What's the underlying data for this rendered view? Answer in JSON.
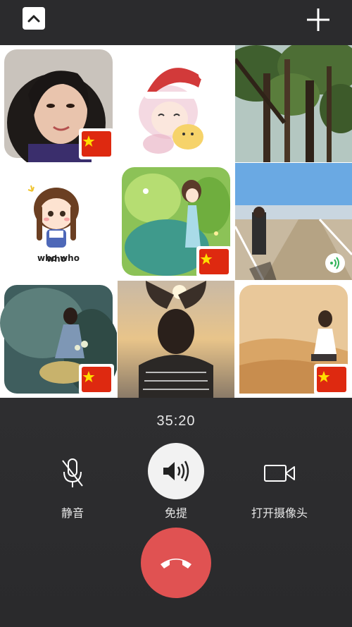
{
  "top_bar": {
    "collapse_icon": "chevron-up-icon",
    "add_icon": "plus-icon"
  },
  "participants": [
    {
      "tile": "participant-1",
      "badge": "china-flag"
    },
    {
      "tile": "participant-2",
      "badge": ""
    },
    {
      "tile": "participant-3",
      "badge": ""
    },
    {
      "tile": "participant-4",
      "badge": "",
      "caption": "who who"
    },
    {
      "tile": "participant-5",
      "badge": "china-flag"
    },
    {
      "tile": "participant-6",
      "badge": "speaking-indicator"
    },
    {
      "tile": "participant-7",
      "badge": "china-flag"
    },
    {
      "tile": "participant-8",
      "badge": ""
    },
    {
      "tile": "participant-9",
      "badge": "china-flag"
    }
  ],
  "call": {
    "timer": "35:20",
    "controls": {
      "mute_label": "静音",
      "mute_icon": "microphone-icon",
      "speaker_label": "免提",
      "speaker_icon": "speaker-icon",
      "camera_label": "打开摄像头",
      "camera_icon": "camera-icon"
    },
    "hangup_icon": "phone-hangup-icon"
  },
  "colors": {
    "background": "#2a2a2c",
    "hangup": "#e05252",
    "speaker_button": "#f2f2f2",
    "flag_red": "#de2910",
    "flag_star": "#ffde00",
    "speaking_green": "#32b45a"
  }
}
